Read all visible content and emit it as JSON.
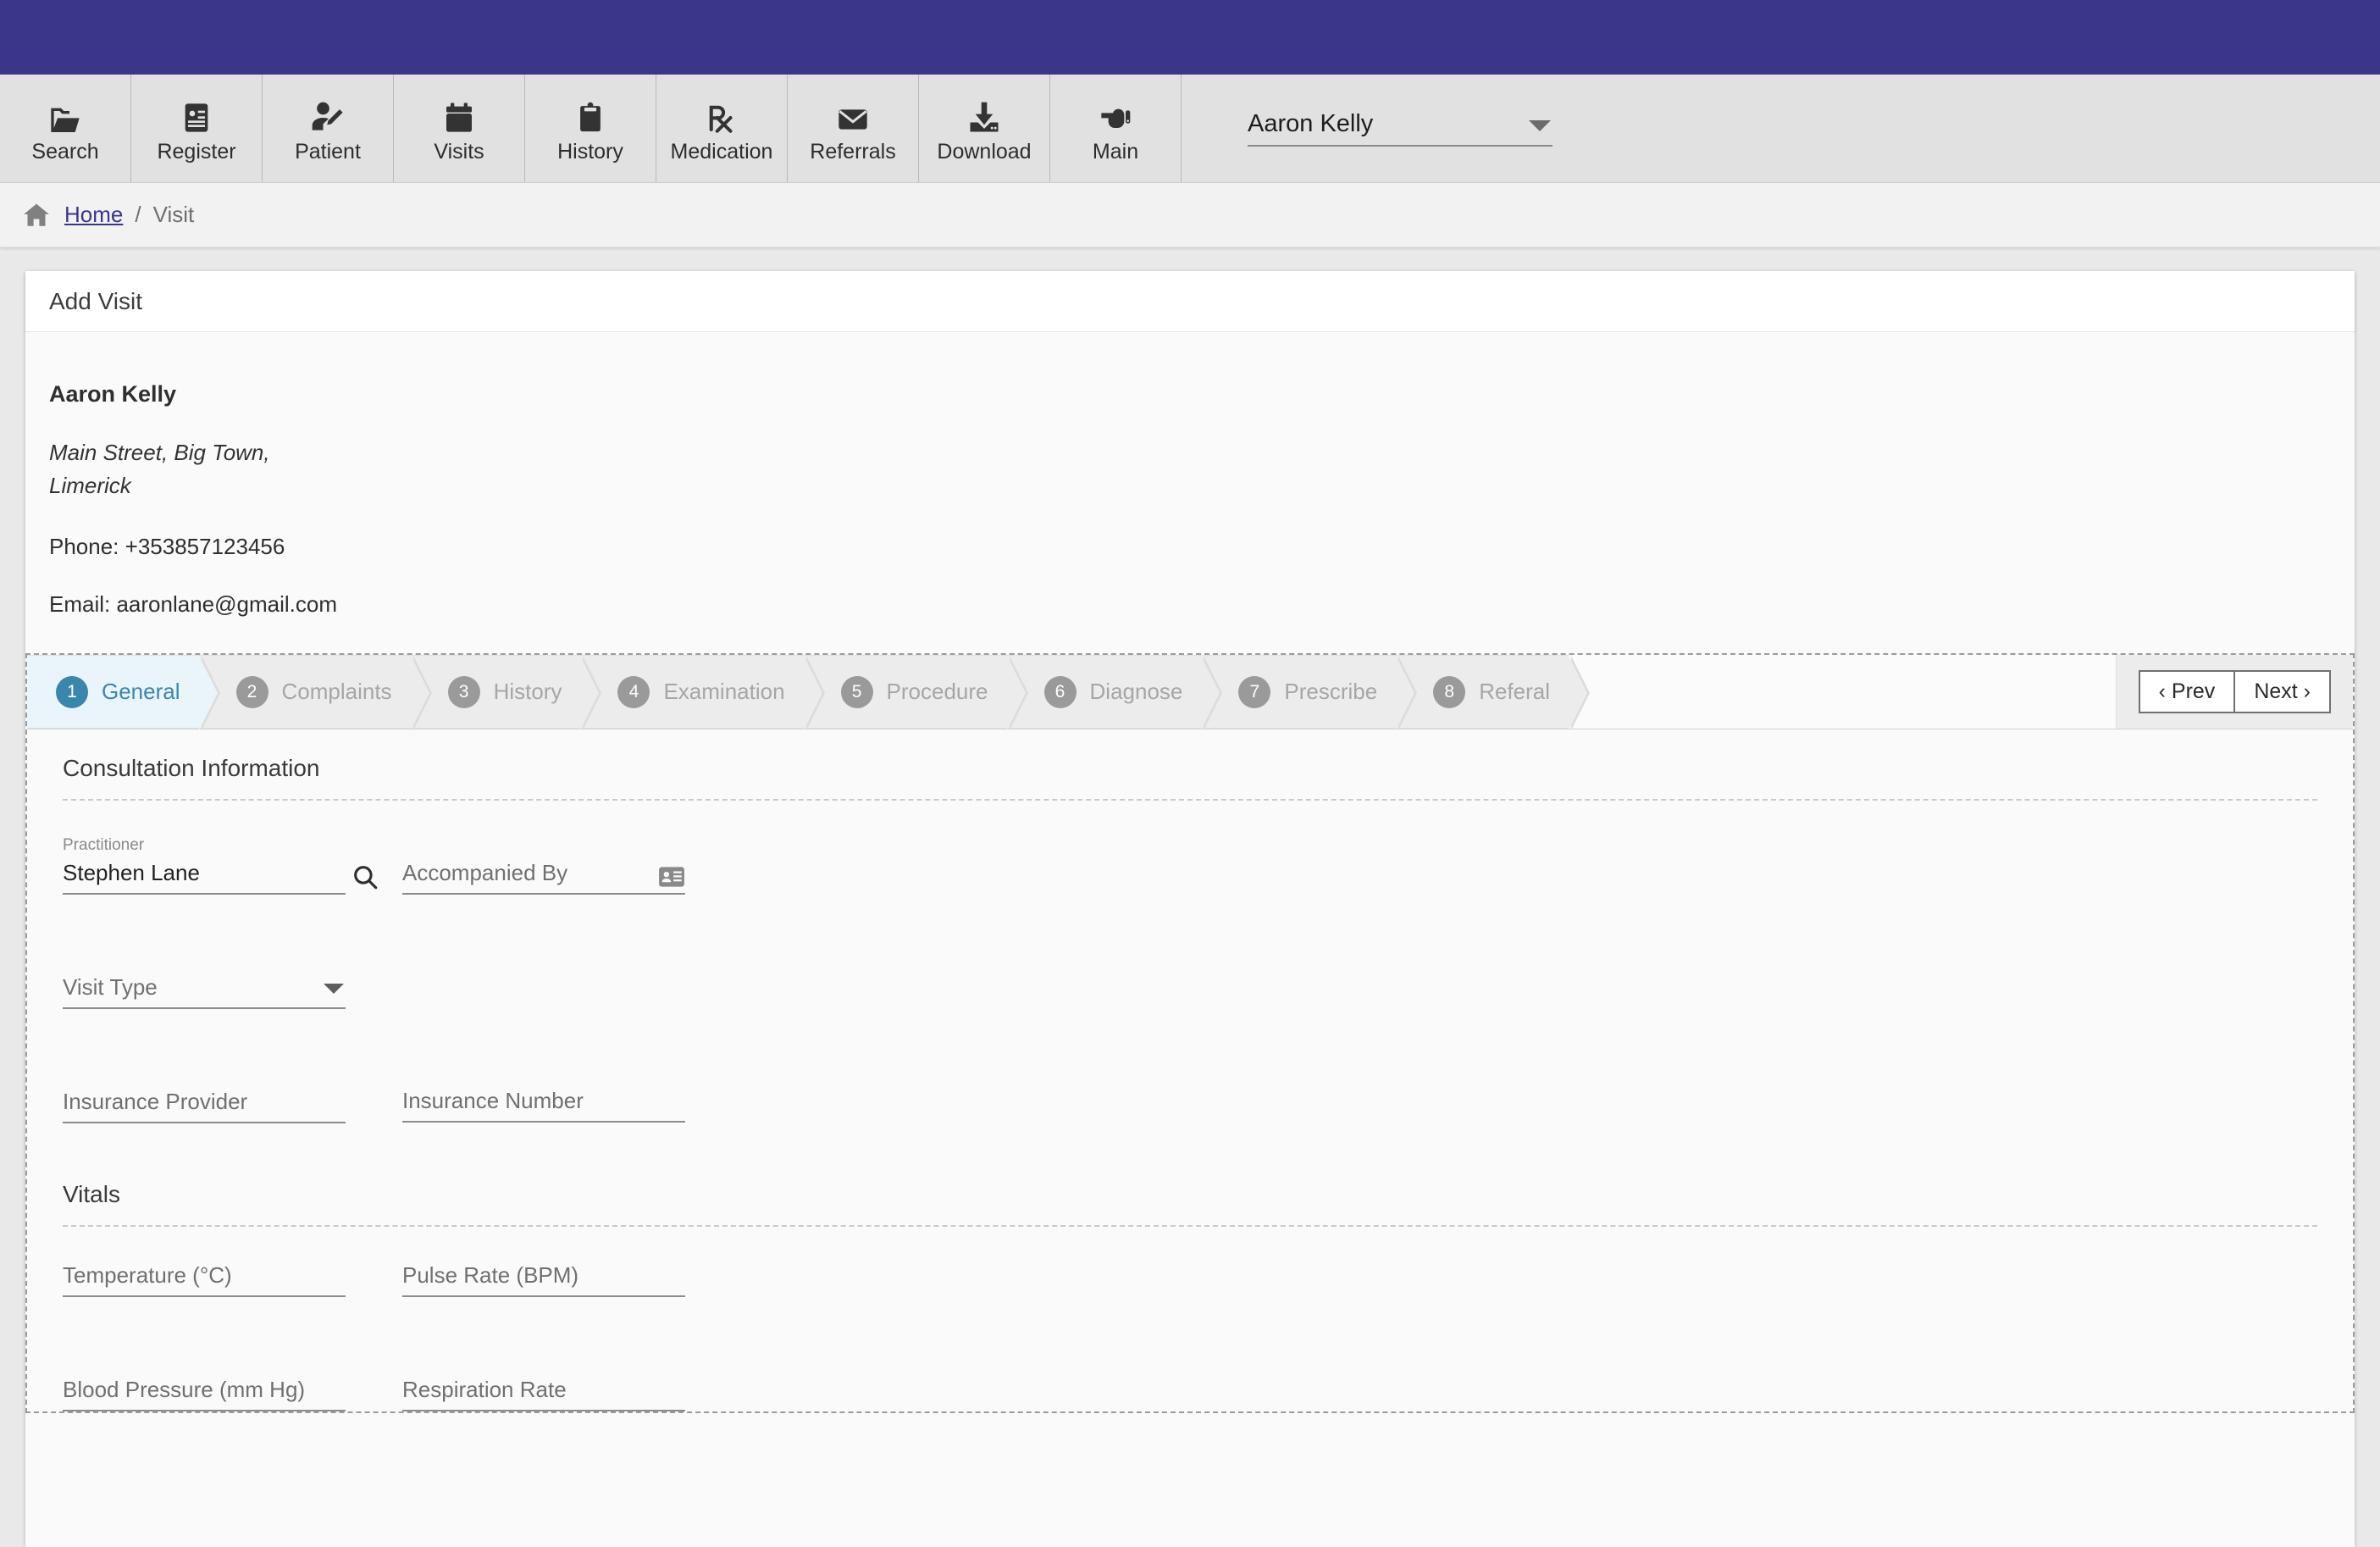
{
  "theme": {
    "header_bar": "#3b3788",
    "toolbar_bg": "#e1e1e1",
    "active_step": "#3a87ad",
    "active_step_bg": "#eaf4fb",
    "link": "#3b3788"
  },
  "toolbar": {
    "items": [
      {
        "label": "Search",
        "icon": "folder-open-icon"
      },
      {
        "label": "Register",
        "icon": "id-card-icon"
      },
      {
        "label": "Patient",
        "icon": "user-edit-icon"
      },
      {
        "label": "Visits",
        "icon": "calendar-icon"
      },
      {
        "label": "History",
        "icon": "clipboard-icon"
      },
      {
        "label": "Medication",
        "icon": "prescription-rx-icon"
      },
      {
        "label": "Referrals",
        "icon": "envelope-icon"
      },
      {
        "label": "Download",
        "icon": "download-icon"
      },
      {
        "label": "Main",
        "icon": "hand-pointer-icon"
      }
    ],
    "patient_select": {
      "value": "Aaron Kelly",
      "icon": "chevron-down-icon"
    }
  },
  "breadcrumb": {
    "home_icon": "home-icon",
    "home": "Home",
    "separator": "/",
    "current": "Visit"
  },
  "card": {
    "title": "Add Visit"
  },
  "patient": {
    "name": "Aaron Kelly",
    "address_line1": "Main Street, Big Town,",
    "address_line2": "Limerick",
    "phone": "Phone: +353857123456",
    "email": "Email: aaronlane@gmail.com"
  },
  "wizard": {
    "steps": [
      {
        "num": "1",
        "label": "General",
        "active": true
      },
      {
        "num": "2",
        "label": "Complaints",
        "active": false
      },
      {
        "num": "3",
        "label": "History",
        "active": false
      },
      {
        "num": "4",
        "label": "Examination",
        "active": false
      },
      {
        "num": "5",
        "label": "Procedure",
        "active": false
      },
      {
        "num": "6",
        "label": "Diagnose",
        "active": false
      },
      {
        "num": "7",
        "label": "Prescribe",
        "active": false
      },
      {
        "num": "8",
        "label": "Referal",
        "active": false
      }
    ],
    "prev_label": "‹ Prev",
    "next_label": "Next ›"
  },
  "form": {
    "consultation": {
      "section_title": "Consultation Information",
      "practitioner": {
        "label": "Practitioner",
        "value": "Stephen Lane",
        "icon": "search-icon"
      },
      "accompanied_by": {
        "placeholder": "Accompanied By",
        "icon": "contact-card-icon"
      },
      "visit_type": {
        "placeholder": "Visit Type",
        "icon": "chevron-down-icon"
      },
      "insurance_provider": {
        "placeholder": "Insurance Provider"
      },
      "insurance_number": {
        "placeholder": "Insurance Number"
      }
    },
    "vitals": {
      "section_title": "Vitals",
      "temperature": {
        "placeholder": "Temperature (°C)"
      },
      "pulse_rate": {
        "placeholder": "Pulse Rate (BPM)"
      },
      "blood_pressure": {
        "placeholder": "Blood Pressure (mm Hg)"
      },
      "respiration_rate": {
        "placeholder": "Respiration Rate"
      }
    }
  }
}
